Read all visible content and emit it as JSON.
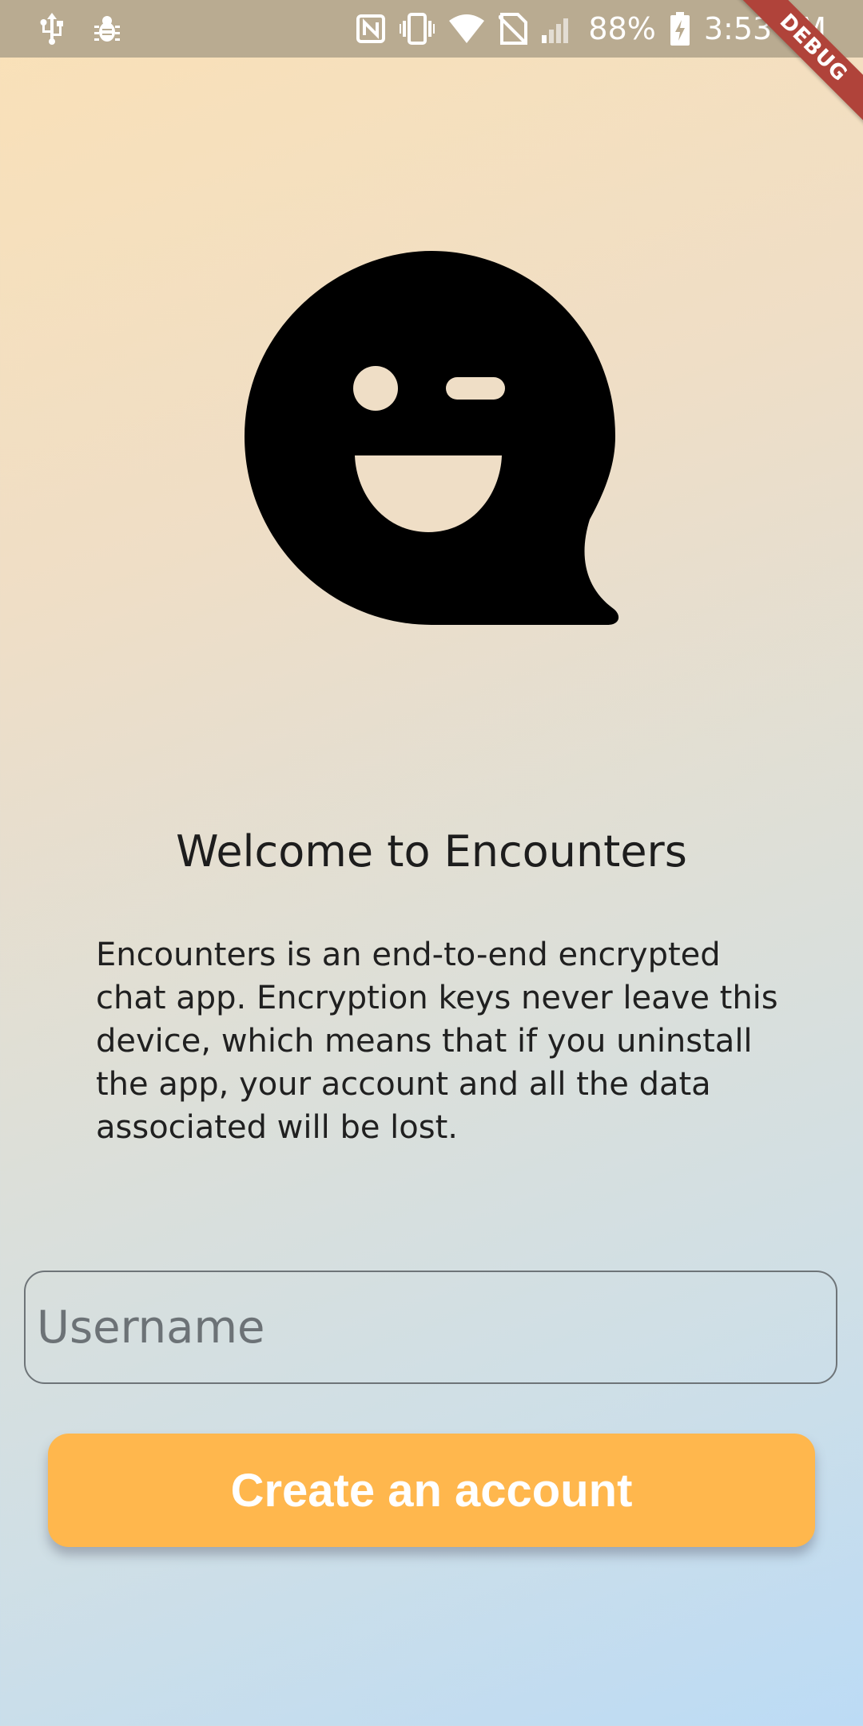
{
  "status_bar": {
    "left_icons": [
      "usb-icon",
      "debug-bug-icon"
    ],
    "right_icons": [
      "nfc-icon",
      "vibrate-icon",
      "wifi-icon",
      "no-sim-icon",
      "signal-icon",
      "battery-charging-icon"
    ],
    "battery_percent": "88%",
    "time": "3:53 PM"
  },
  "debug_banner": {
    "label": "DEBUG"
  },
  "logo": {
    "icon": "winking-chat-bubble-icon"
  },
  "welcome": {
    "title": "Welcome to Encounters",
    "description": "Encounters is an end-to-end encrypted chat app. Encryption keys never leave this device, which means that if you uninstall the app, your account and all the data associated will be lost."
  },
  "form": {
    "username_placeholder": "Username",
    "username_value": "",
    "create_button_label": "Create an account"
  },
  "colors": {
    "accent": "#ffb74d",
    "status_bar": "#b9ab91",
    "debug_banner": "#b0433a",
    "text_primary": "#1d1d1d"
  }
}
